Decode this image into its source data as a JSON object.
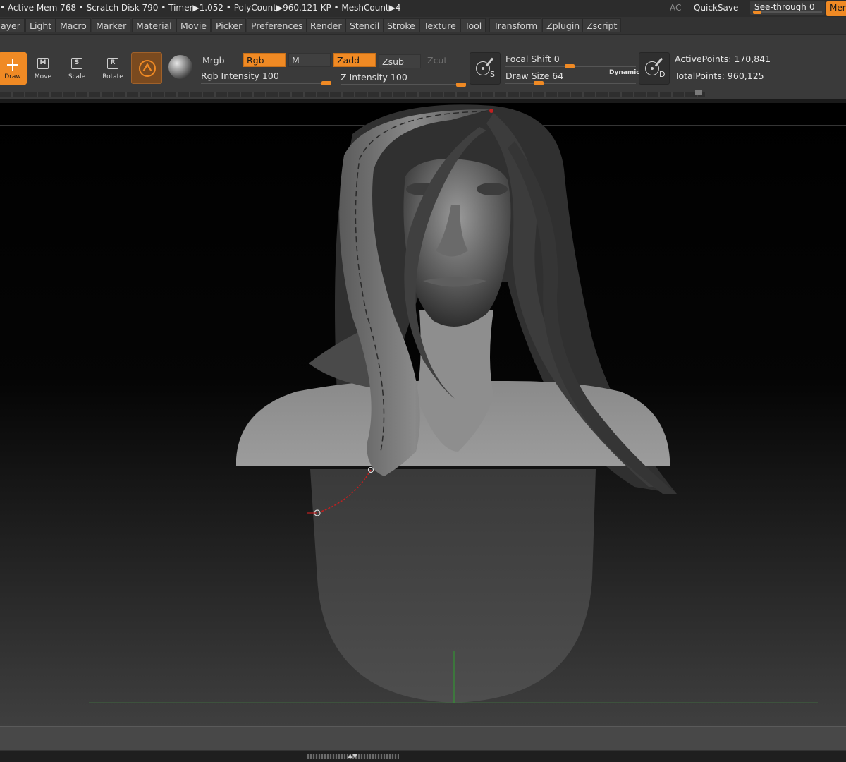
{
  "status_bar": {
    "text": "• Active Mem 768 • Scratch Disk 790 •  Timer▶1.052 • PolyCount▶960.121 KP  • MeshCount▶4",
    "ac": "AC",
    "quicksave": "QuickSave",
    "see_through_label": "See-through",
    "see_through_value": "0",
    "see_through_level": 0,
    "menus_label": "Menus"
  },
  "menu_bar": {
    "items": [
      "ayer",
      "Light",
      "Macro",
      "Marker",
      "Material",
      "Movie",
      "Picker",
      "Preferences",
      "Render",
      "Stencil",
      "Stroke",
      "Texture",
      "Tool",
      "Transform",
      "Zplugin",
      "Zscript"
    ]
  },
  "toolbar": {
    "tools": [
      {
        "label": "Draw",
        "icon": "draw-icon",
        "active": true
      },
      {
        "label": "Move",
        "icon": "move-icon",
        "letter": "M",
        "active": false
      },
      {
        "label": "Scale",
        "icon": "scale-icon",
        "letter": "S",
        "active": false
      },
      {
        "label": "Rotate",
        "icon": "rotate-icon",
        "letter": "R",
        "active": false
      }
    ],
    "toggles": {
      "mrgb": "Mrgb",
      "rgb": "Rgb",
      "m": "M",
      "zadd": "Zadd",
      "zsub": "Zsub",
      "zcut": "Zcut"
    },
    "rgb_intensity_label": "Rgb Intensity 100",
    "rgb_intensity_value": 100,
    "z_intensity_label": "Z Intensity 100",
    "z_intensity_value": 100,
    "focal_shift_label": "Focal Shift 0",
    "focal_shift_value": 0,
    "draw_size_label": "Draw Size 64",
    "draw_size_value": 64,
    "dynamic_label": "Dynamic",
    "sym_s_letter": "S",
    "sym_d_letter": "D",
    "active_points": "ActivePoints: 170,841",
    "total_points": "TotalPoints: 960,125"
  },
  "colors": {
    "accent": "#f08a24",
    "panel": "#3a3a3a",
    "canvas_top": "#000000",
    "canvas_bottom": "#3f3f3f"
  }
}
